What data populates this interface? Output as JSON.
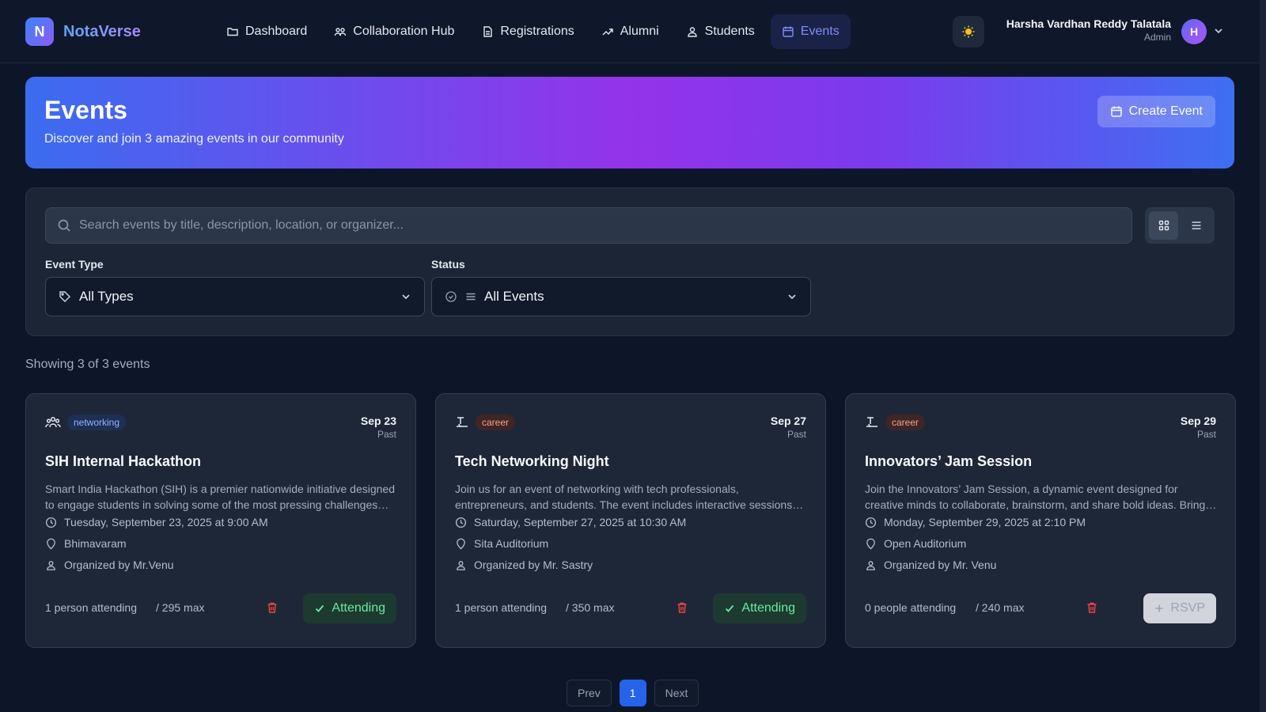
{
  "app": {
    "logo_letter": "N",
    "name": "NotaVerse"
  },
  "nav": {
    "items": [
      {
        "label": "Dashboard",
        "icon": "folder-icon"
      },
      {
        "label": "Collaboration Hub",
        "icon": "users-icon"
      },
      {
        "label": "Registrations",
        "icon": "document-icon"
      },
      {
        "label": "Alumni",
        "icon": "graduation-icon"
      },
      {
        "label": "Students",
        "icon": "user-icon"
      },
      {
        "label": "Events",
        "icon": "calendar-icon",
        "active": true
      }
    ]
  },
  "user": {
    "name": "Harsha Vardhan Reddy Talatala",
    "role": "Admin",
    "initial": "H"
  },
  "hero": {
    "title": "Events",
    "subtitle": "Discover and join 3 amazing events in our community",
    "create_label": "Create Event"
  },
  "filters": {
    "search_placeholder": "Search events by title, description, location, or organizer...",
    "event_type_label": "Event Type",
    "event_type_value": "All Types",
    "status_label": "Status",
    "status_value": "All Events"
  },
  "showing": "Showing 3 of 3 events",
  "events": [
    {
      "tag": "networking",
      "date": "Sep 23",
      "status": "Past",
      "title": "SIH Internal Hackathon",
      "description": "Smart India Hackathon (SIH) is a premier nationwide initiative designed to engage students in solving some of the most pressing challenges faced in our daily lives.",
      "datetime": "Tuesday, September 23, 2025 at 9:00 AM",
      "location": "Bhimavaram",
      "organizer": "Organized by Mr.Venu",
      "attending": "1 person attending",
      "max": "/ 295 max",
      "action": "Attending"
    },
    {
      "tag": "career",
      "date": "Sep 27",
      "status": "Past",
      "title": "Tech Networking Night",
      "description": "Join us for an event of networking with tech professionals, entrepreneurs, and students. The event includes interactive sessions and more.",
      "datetime": "Saturday, September 27, 2025 at 10:30 AM",
      "location": "Sita Auditorium",
      "organizer": "Organized by Mr. Sastry",
      "attending": "1 person attending",
      "max": "/ 350 max",
      "action": "Attending"
    },
    {
      "tag": "career",
      "date": "Sep 29",
      "status": "Past",
      "title": "Innovators’ Jam Session",
      "description": "Join the Innovators’ Jam Session, a dynamic event designed for creative minds to collaborate, brainstorm, and share bold ideas. Bring your passion.",
      "datetime": "Monday, September 29, 2025 at 2:10 PM",
      "location": "Open Auditorium",
      "organizer": "Organized by Mr. Venu",
      "attending": "0 people attending",
      "max": "/ 240 max",
      "action": "RSVP"
    }
  ],
  "pagination": {
    "prev": "Prev",
    "current": "1",
    "next": "Next"
  },
  "colors": {
    "background": "#0d1628",
    "accent": "#2563eb",
    "nav_active": "#818cf8",
    "attending": "#6ee7a6",
    "delete": "#ef4444"
  }
}
